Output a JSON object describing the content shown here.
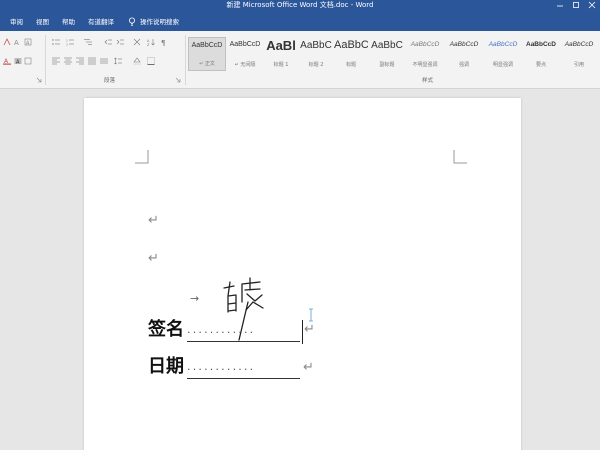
{
  "window": {
    "title": "新建 Microsoft Office Word 文档.doc  -  Word"
  },
  "tabs": [
    {
      "label": "审阅"
    },
    {
      "label": "视图"
    },
    {
      "label": "帮助"
    },
    {
      "label": "有道翻译"
    }
  ],
  "tell_me": {
    "label": "操作说明搜索",
    "icon": "lightbulb-icon"
  },
  "ribbon": {
    "paragraph_group_label": "段落",
    "styles_group_label": "样式",
    "styles": [
      {
        "sample": "AaBbCcD",
        "name": "↵ 正文",
        "selected": true
      },
      {
        "sample": "AaBbCcD",
        "name": "↵ 无间隔",
        "selected": false
      },
      {
        "sample": "AaBl",
        "name": "标题 1",
        "selected": false
      },
      {
        "sample": "AaBbC",
        "name": "标题 2",
        "selected": false
      },
      {
        "sample": "AaBbC",
        "name": "标题",
        "selected": false
      },
      {
        "sample": "AaBbC",
        "name": "副标题",
        "selected": false
      },
      {
        "sample": "AaBbCcD",
        "name": "不明显强调",
        "selected": false
      },
      {
        "sample": "AaBbCcD",
        "name": "强调",
        "selected": false
      },
      {
        "sample": "AaBbCcD",
        "name": "明显强调",
        "selected": false
      },
      {
        "sample": "AaBbCcD",
        "name": "要点",
        "selected": false
      },
      {
        "sample": "AaBbCcD",
        "name": "引用",
        "selected": false
      }
    ]
  },
  "document": {
    "paragraph_mark": "↵",
    "tab_arrow": "→",
    "signature_label": "签名",
    "date_label": "日期",
    "dot_leader": "············",
    "signature_handwriting": "handwritten-signature"
  },
  "colors": {
    "ribbon_blue": "#2b579a",
    "ribbon_bg": "#f3f3f3",
    "canvas_bg": "#e6e6e6"
  }
}
